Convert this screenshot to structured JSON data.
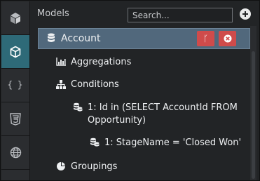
{
  "header": {
    "title": "Models",
    "search_placeholder": "Search..."
  },
  "tree": {
    "selected": {
      "label": "Account",
      "icon": "database-icon",
      "actions": [
        {
          "name": "branch-button",
          "glyph": "ᚴ"
        },
        {
          "name": "remove-button",
          "glyph": "✕"
        }
      ]
    },
    "items": [
      {
        "label": "Aggregations",
        "icon": "bar-chart-icon"
      },
      {
        "label": "Conditions",
        "icon": "sitemap-icon"
      },
      {
        "label": "1: Id in (SELECT AccountId FROM Opportunity)",
        "icon": "database-icon"
      },
      {
        "label": "1: StageName = 'Closed Won'",
        "icon": "database-icon"
      },
      {
        "label": "Groupings",
        "icon": "pie-chart-icon"
      }
    ]
  },
  "rail": [
    "puzzle-cube-icon",
    "cube-icon",
    "braces-icon",
    "css3-icon",
    "globe-icon"
  ],
  "rail_labels": {
    "braces": "{ }"
  },
  "colors": {
    "active_rail": "#2e6a78",
    "selected_row": "#51687c",
    "danger": "#cf4b4b"
  }
}
